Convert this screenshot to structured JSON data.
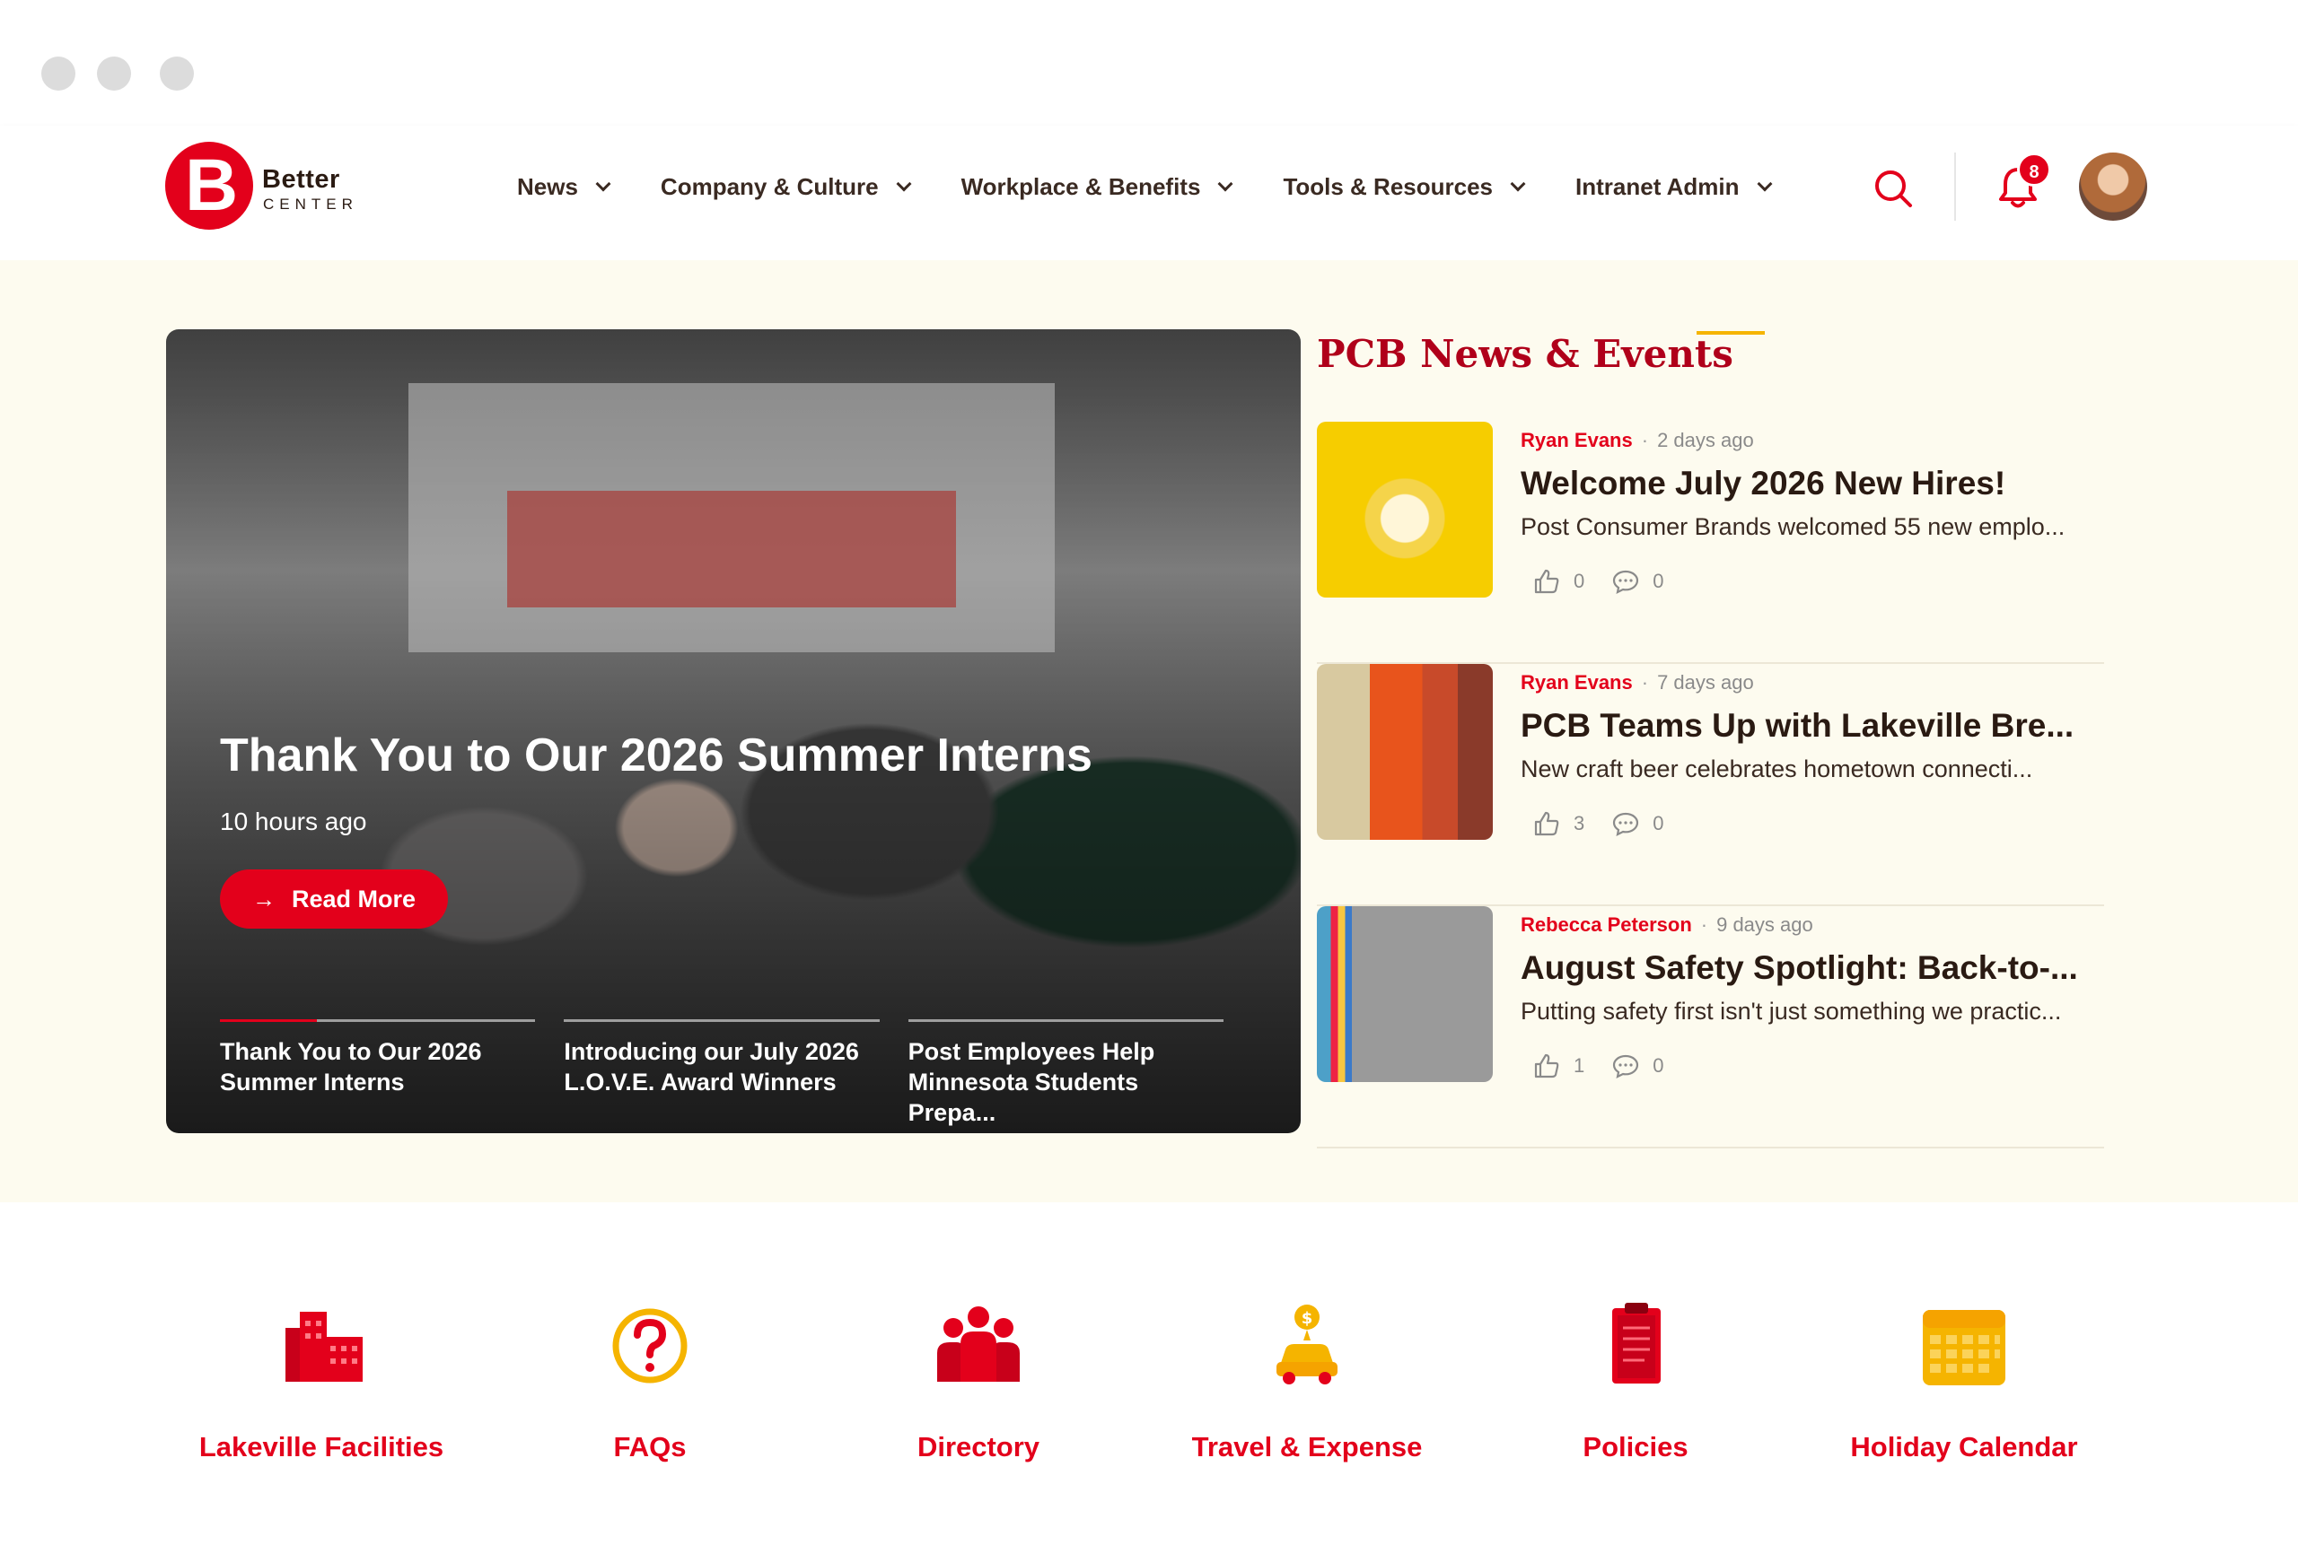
{
  "brand": {
    "name_line1": "Better",
    "name_line2": "CENTER",
    "mark_letter": "B",
    "accent": "#e3001b",
    "gold": "#f5b400"
  },
  "nav": {
    "items": [
      {
        "label": "News"
      },
      {
        "label": "Company & Culture"
      },
      {
        "label": "Workplace & Benefits"
      },
      {
        "label": "Tools & Resources"
      },
      {
        "label": "Intranet Admin"
      }
    ],
    "notification_count": "8"
  },
  "hero": {
    "title": "Thank You to Our 2026 Summer Interns",
    "time": "10 hours ago",
    "read_more": "Read More",
    "tabs": [
      {
        "line1": "Thank You to Our 2026",
        "line2": "Summer Interns",
        "active": true
      },
      {
        "line1": "Introducing our July 2026",
        "line2": "L.O.V.E. Award Winners",
        "active": false
      },
      {
        "line1": "Post Employees Help",
        "line2": "Minnesota Students Prepa...",
        "active": false
      }
    ]
  },
  "news": {
    "heading": "PCB News & Events",
    "items": [
      {
        "author": "Ryan Evans",
        "ago": "2 days ago",
        "title": "Welcome July 2026 New Hires!",
        "desc": "Post Consumer Brands welcomed 55 new emplo...",
        "likes": "0",
        "comments": "0"
      },
      {
        "author": "Ryan Evans",
        "ago": "7 days ago",
        "title": "PCB Teams Up with Lakeville Bre...",
        "desc": "New craft beer celebrates hometown connecti...",
        "likes": "3",
        "comments": "0"
      },
      {
        "author": "Rebecca Peterson",
        "ago": "9 days ago",
        "title": "August Safety Spotlight: Back-to-...",
        "desc": "Putting safety first isn't just something we practic...",
        "likes": "1",
        "comments": "0"
      }
    ]
  },
  "quick_links": [
    {
      "label": "Lakeville Facilities",
      "icon": "building-icon"
    },
    {
      "label": "FAQs",
      "icon": "question-icon"
    },
    {
      "label": "Directory",
      "icon": "people-icon"
    },
    {
      "label": "Travel & Expense",
      "icon": "car-icon"
    },
    {
      "label": "Policies",
      "icon": "clipboard-icon"
    },
    {
      "label": "Holiday Calendar",
      "icon": "calendar-icon"
    }
  ]
}
